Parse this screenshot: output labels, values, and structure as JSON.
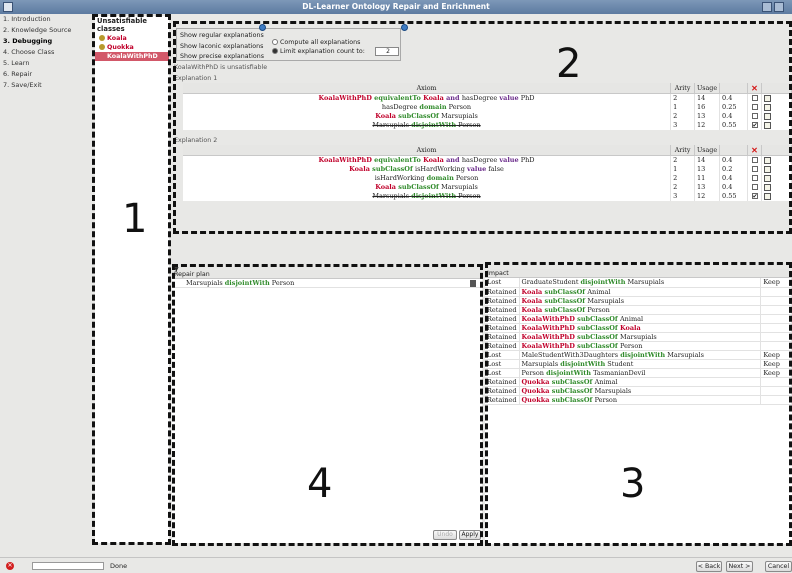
{
  "window": {
    "title": "DL-Learner Ontology Repair and Enrichment"
  },
  "steps": [
    "1. Introduction",
    "2. Knowledge Source",
    "3. Debugging",
    "4. Choose Class",
    "5. Learn",
    "6. Repair",
    "7. Save/Exit"
  ],
  "active_step": "3. Debugging",
  "unsatisfiable": {
    "title": "Unsatisfiable classes",
    "items": [
      "Koala",
      "Quokka",
      "KoalaWithPhD"
    ],
    "selected": "KoalaWithPhD"
  },
  "options": {
    "show_regular": "Show regular explanations",
    "show_laconic": "Show laconic explanations",
    "show_precise": "Show precise explanations",
    "compute_all": "Compute all explanations",
    "limit_count": "Limit explanation count to:",
    "limit_value": "2"
  },
  "unsatisfiable_note": "KoalaWithPhD is unsatisfiable",
  "explanation_headers": {
    "axiom": "Axiom",
    "arity": "Arity",
    "usage": "Usage"
  },
  "explanation1": {
    "label": "Explanation 1",
    "rows": [
      {
        "axiom": [
          {
            "t": "KoalaWithPhD",
            "c": "cls"
          },
          {
            "t": " equivalentTo ",
            "c": "kw"
          },
          {
            "t": "Koala",
            "c": "cls"
          },
          {
            "t": " and ",
            "c": "kw2"
          },
          {
            "t": "hasDegree ",
            "c": ""
          },
          {
            "t": "value",
            "c": "kw2"
          },
          {
            "t": " PhD",
            "c": ""
          }
        ],
        "arity": "2",
        "usage": "14",
        "score": "0.4",
        "checked": false,
        "strike": false
      },
      {
        "axiom": [
          {
            "t": "hasDegree ",
            "c": ""
          },
          {
            "t": "domain",
            "c": "kw"
          },
          {
            "t": " Person",
            "c": ""
          }
        ],
        "arity": "1",
        "usage": "16",
        "score": "0.25",
        "checked": false,
        "strike": false
      },
      {
        "axiom": [
          {
            "t": "Koala",
            "c": "cls"
          },
          {
            "t": " subClassOf ",
            "c": "kw"
          },
          {
            "t": "Marsupials",
            "c": ""
          }
        ],
        "arity": "2",
        "usage": "13",
        "score": "0.4",
        "checked": false,
        "strike": false
      },
      {
        "axiom": [
          {
            "t": "Marsupials ",
            "c": ""
          },
          {
            "t": "disjointWith",
            "c": "kw"
          },
          {
            "t": " Person",
            "c": ""
          }
        ],
        "arity": "3",
        "usage": "12",
        "score": "0.55",
        "checked": true,
        "strike": true
      }
    ]
  },
  "explanation2": {
    "label": "Explanation 2",
    "rows": [
      {
        "axiom": [
          {
            "t": "KoalaWithPhD",
            "c": "cls"
          },
          {
            "t": " equivalentTo ",
            "c": "kw"
          },
          {
            "t": "Koala",
            "c": "cls"
          },
          {
            "t": " and ",
            "c": "kw2"
          },
          {
            "t": "hasDegree ",
            "c": ""
          },
          {
            "t": "value",
            "c": "kw2"
          },
          {
            "t": " PhD",
            "c": ""
          }
        ],
        "arity": "2",
        "usage": "14",
        "score": "0.4",
        "checked": false,
        "strike": false
      },
      {
        "axiom": [
          {
            "t": "Koala",
            "c": "cls"
          },
          {
            "t": " subClassOf ",
            "c": "kw"
          },
          {
            "t": "isHardWorking ",
            "c": ""
          },
          {
            "t": "value",
            "c": "kw2"
          },
          {
            "t": " false",
            "c": ""
          }
        ],
        "arity": "1",
        "usage": "13",
        "score": "0.2",
        "checked": false,
        "strike": false
      },
      {
        "axiom": [
          {
            "t": "isHardWorking ",
            "c": ""
          },
          {
            "t": "domain",
            "c": "kw"
          },
          {
            "t": " Person",
            "c": ""
          }
        ],
        "arity": "2",
        "usage": "11",
        "score": "0.4",
        "checked": false,
        "strike": false
      },
      {
        "axiom": [
          {
            "t": "Koala",
            "c": "cls"
          },
          {
            "t": " subClassOf ",
            "c": "kw"
          },
          {
            "t": "Marsupials",
            "c": ""
          }
        ],
        "arity": "2",
        "usage": "13",
        "score": "0.4",
        "checked": false,
        "strike": false
      },
      {
        "axiom": [
          {
            "t": "Marsupials ",
            "c": ""
          },
          {
            "t": "disjointWith",
            "c": "kw"
          },
          {
            "t": " Person",
            "c": ""
          }
        ],
        "arity": "3",
        "usage": "12",
        "score": "0.55",
        "checked": true,
        "strike": true
      }
    ]
  },
  "repair_plan": {
    "header": "Repair plan",
    "items": [
      [
        {
          "t": "Marsupials ",
          "c": ""
        },
        {
          "t": "disjointWith",
          "c": "kw"
        },
        {
          "t": " Person",
          "c": ""
        }
      ]
    ],
    "undo": "Undo",
    "apply": "Apply"
  },
  "impact": {
    "header": "Impact",
    "rows": [
      {
        "status": "Lost",
        "axiom": [
          {
            "t": "GraduateStudent ",
            "c": ""
          },
          {
            "t": "disjointWith",
            "c": "kw"
          },
          {
            "t": " Marsupials",
            "c": ""
          }
        ],
        "action": "Keep"
      },
      {
        "status": "Retained",
        "axiom": [
          {
            "t": "Koala",
            "c": "cls"
          },
          {
            "t": " subClassOf ",
            "c": "kw"
          },
          {
            "t": "Animal",
            "c": ""
          }
        ],
        "action": ""
      },
      {
        "status": "Retained",
        "axiom": [
          {
            "t": "Koala",
            "c": "cls"
          },
          {
            "t": " subClassOf ",
            "c": "kw"
          },
          {
            "t": "Marsupials",
            "c": ""
          }
        ],
        "action": ""
      },
      {
        "status": "Retained",
        "axiom": [
          {
            "t": "Koala",
            "c": "cls"
          },
          {
            "t": " subClassOf ",
            "c": "kw"
          },
          {
            "t": "Person",
            "c": ""
          }
        ],
        "action": ""
      },
      {
        "status": "Retained",
        "axiom": [
          {
            "t": "KoalaWithPhD",
            "c": "cls"
          },
          {
            "t": " subClassOf ",
            "c": "kw"
          },
          {
            "t": "Animal",
            "c": ""
          }
        ],
        "action": ""
      },
      {
        "status": "Retained",
        "axiom": [
          {
            "t": "KoalaWithPhD",
            "c": "cls"
          },
          {
            "t": " subClassOf ",
            "c": "kw"
          },
          {
            "t": "Koala",
            "c": "cls"
          }
        ],
        "action": ""
      },
      {
        "status": "Retained",
        "axiom": [
          {
            "t": "KoalaWithPhD",
            "c": "cls"
          },
          {
            "t": " subClassOf ",
            "c": "kw"
          },
          {
            "t": "Marsupials",
            "c": ""
          }
        ],
        "action": ""
      },
      {
        "status": "Retained",
        "axiom": [
          {
            "t": "KoalaWithPhD",
            "c": "cls"
          },
          {
            "t": " subClassOf ",
            "c": "kw"
          },
          {
            "t": "Person",
            "c": ""
          }
        ],
        "action": ""
      },
      {
        "status": "Lost",
        "axiom": [
          {
            "t": "MaleStudentWith3Daughters ",
            "c": ""
          },
          {
            "t": "disjointWith",
            "c": "kw"
          },
          {
            "t": " Marsupials",
            "c": ""
          }
        ],
        "action": "Keep"
      },
      {
        "status": "Lost",
        "axiom": [
          {
            "t": "Marsupials ",
            "c": ""
          },
          {
            "t": "disjointWith",
            "c": "kw"
          },
          {
            "t": " Student",
            "c": ""
          }
        ],
        "action": "Keep"
      },
      {
        "status": "Lost",
        "axiom": [
          {
            "t": "Person ",
            "c": ""
          },
          {
            "t": "disjointWith",
            "c": "kw"
          },
          {
            "t": " TasmanianDevil",
            "c": ""
          }
        ],
        "action": "Keep"
      },
      {
        "status": "Retained",
        "axiom": [
          {
            "t": "Quokka",
            "c": "cls"
          },
          {
            "t": " subClassOf ",
            "c": "kw"
          },
          {
            "t": "Animal",
            "c": ""
          }
        ],
        "action": ""
      },
      {
        "status": "Retained",
        "axiom": [
          {
            "t": "Quokka",
            "c": "cls"
          },
          {
            "t": " subClassOf ",
            "c": "kw"
          },
          {
            "t": "Marsupials",
            "c": ""
          }
        ],
        "action": ""
      },
      {
        "status": "Retained",
        "axiom": [
          {
            "t": "Quokka",
            "c": "cls"
          },
          {
            "t": " subClassOf ",
            "c": "kw"
          },
          {
            "t": "Person",
            "c": ""
          }
        ],
        "action": ""
      }
    ]
  },
  "annotations": {
    "n1": "1",
    "n2": "2",
    "n3": "3",
    "n4": "4"
  },
  "status": {
    "text": "Done",
    "back": "< Back",
    "next": "Next >",
    "cancel": "Cancel"
  }
}
